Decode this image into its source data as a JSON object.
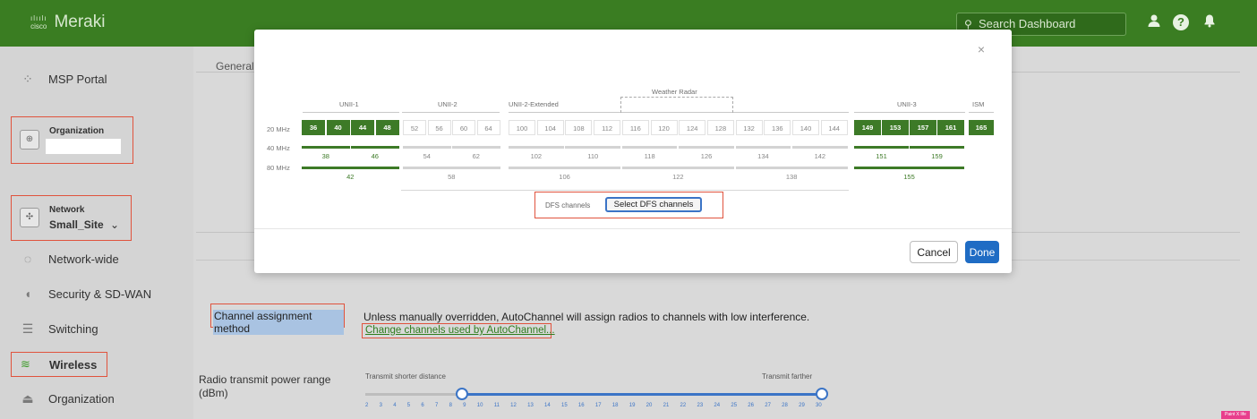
{
  "header": {
    "brand_small": "cisco",
    "brand": "Meraki",
    "search_placeholder": "Search Dashboard",
    "icons": [
      "user-icon",
      "help-icon",
      "bell-icon"
    ]
  },
  "sidebar": {
    "msp_portal": "MSP Portal",
    "organization_title": "Organization",
    "network_title": "Network",
    "network_name": "Small_Site",
    "network_chevron": "⌄",
    "items": [
      {
        "label": "Network-wide",
        "icon": "network-wide-icon"
      },
      {
        "label": "Security & SD-WAN",
        "icon": "shield-icon"
      },
      {
        "label": "Switching",
        "icon": "switch-icon"
      },
      {
        "label": "Wireless",
        "icon": "wifi-icon"
      },
      {
        "label": "Organization",
        "icon": "organization-icon"
      }
    ]
  },
  "main": {
    "tab_general": "General",
    "channel_assignment_label": "Channel assignment method",
    "channel_assignment_desc": "Unless manually overridden, AutoChannel will assign radios to channels with low interference.",
    "change_channels_link": "Change channels used by AutoChannel...",
    "radio_power_label": "Radio transmit power range (dBm)",
    "transmit_shorter": "Transmit shorter distance",
    "transmit_farther": "Transmit farther",
    "power_ticks": [
      "2",
      "3",
      "4",
      "5",
      "6",
      "7",
      "8",
      "9",
      "10",
      "11",
      "12",
      "13",
      "14",
      "15",
      "16",
      "17",
      "18",
      "19",
      "20",
      "21",
      "22",
      "23",
      "24",
      "25",
      "26",
      "27",
      "28",
      "29",
      "30"
    ],
    "power_min": 8,
    "power_max": 30
  },
  "modal": {
    "close": "×",
    "bands": {
      "unii1": "UNII-1",
      "unii2": "UNII-2",
      "unii2ext": "UNII-2-Extended",
      "weather": "Weather Radar",
      "unii3": "UNII-3",
      "ism": "ISM"
    },
    "rows": {
      "r20": "20 MHz",
      "r40": "40 MHz",
      "r80": "80 MHz"
    },
    "channels_20": [
      {
        "n": "36",
        "on": true
      },
      {
        "n": "40",
        "on": true
      },
      {
        "n": "44",
        "on": true
      },
      {
        "n": "48",
        "on": true
      },
      {
        "n": "52",
        "on": false
      },
      {
        "n": "56",
        "on": false
      },
      {
        "n": "60",
        "on": false
      },
      {
        "n": "64",
        "on": false
      },
      {
        "n": "100",
        "on": false
      },
      {
        "n": "104",
        "on": false
      },
      {
        "n": "108",
        "on": false
      },
      {
        "n": "112",
        "on": false
      },
      {
        "n": "116",
        "on": false
      },
      {
        "n": "120",
        "on": false
      },
      {
        "n": "124",
        "on": false
      },
      {
        "n": "128",
        "on": false
      },
      {
        "n": "132",
        "on": false
      },
      {
        "n": "136",
        "on": false
      },
      {
        "n": "140",
        "on": false
      },
      {
        "n": "144",
        "on": false
      },
      {
        "n": "149",
        "on": true
      },
      {
        "n": "153",
        "on": true
      },
      {
        "n": "157",
        "on": true
      },
      {
        "n": "161",
        "on": true
      },
      {
        "n": "165",
        "on": true
      }
    ],
    "channels_40": [
      {
        "n": "38",
        "on": true
      },
      {
        "n": "46",
        "on": true
      },
      {
        "n": "54",
        "on": false
      },
      {
        "n": "62",
        "on": false
      },
      {
        "n": "102",
        "on": false
      },
      {
        "n": "110",
        "on": false
      },
      {
        "n": "118",
        "on": false
      },
      {
        "n": "126",
        "on": false
      },
      {
        "n": "134",
        "on": false
      },
      {
        "n": "142",
        "on": false
      },
      {
        "n": "151",
        "on": true
      },
      {
        "n": "159",
        "on": true
      }
    ],
    "channels_80": [
      {
        "n": "42",
        "on": true
      },
      {
        "n": "58",
        "on": false
      },
      {
        "n": "106",
        "on": false
      },
      {
        "n": "122",
        "on": false
      },
      {
        "n": "138",
        "on": false
      },
      {
        "n": "155",
        "on": true
      }
    ],
    "dfs_label": "DFS channels",
    "dfs_button": "Select DFS channels",
    "cancel": "Cancel",
    "done": "Done"
  },
  "badge": "Paint X life"
}
